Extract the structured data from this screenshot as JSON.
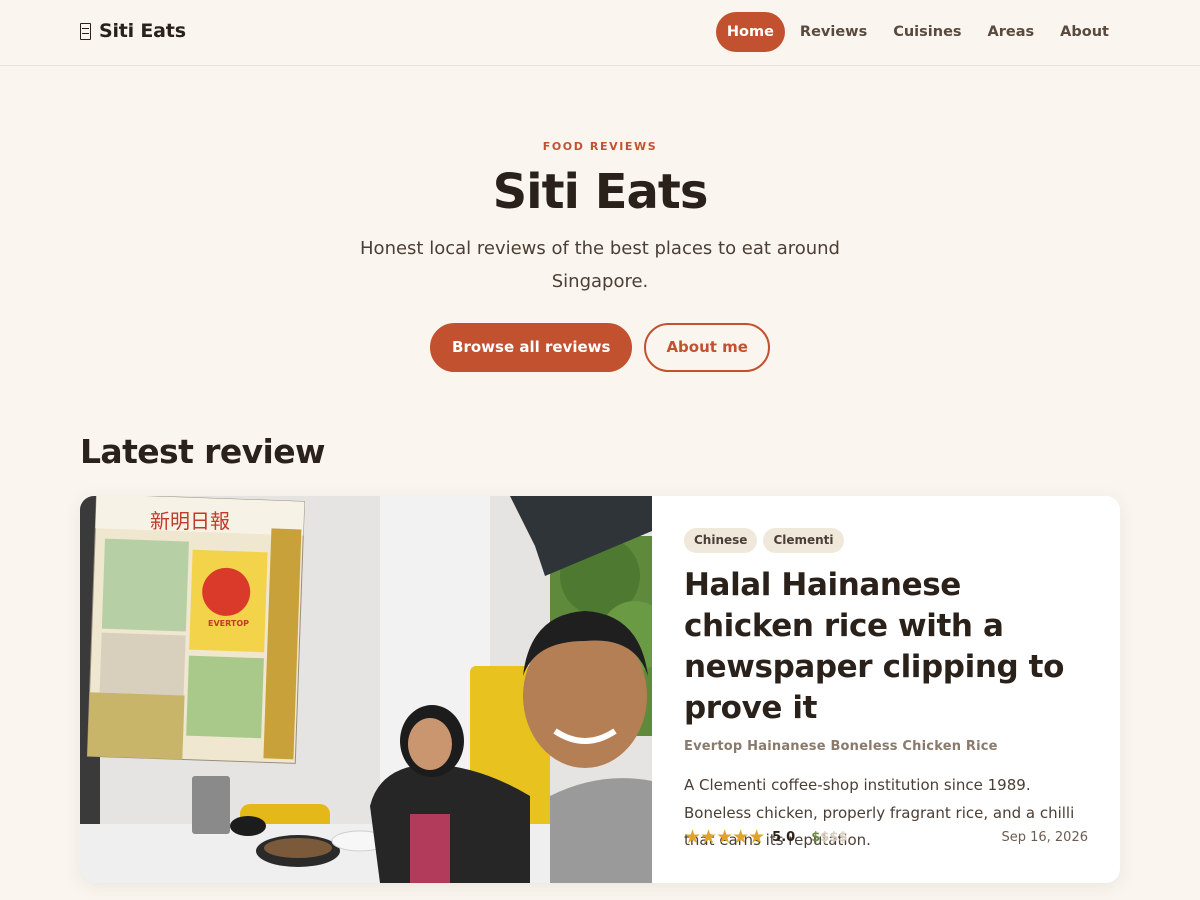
{
  "header": {
    "brand": "Siti Eats",
    "nav": [
      {
        "label": "Home",
        "active": true
      },
      {
        "label": "Reviews",
        "active": false
      },
      {
        "label": "Cuisines",
        "active": false
      },
      {
        "label": "Areas",
        "active": false
      },
      {
        "label": "About",
        "active": false
      }
    ]
  },
  "hero": {
    "eyebrow": "FOOD REVIEWS",
    "title": "Siti Eats",
    "subtitle": "Honest local reviews of the best places to eat around Singapore.",
    "primary_button": "Browse all reviews",
    "secondary_button": "About me"
  },
  "latest": {
    "section_title": "Latest review",
    "tags": [
      "Chinese",
      "Clementi"
    ],
    "title": "Halal Hainanese chicken rice with a newspaper clipping to prove it",
    "place": "Evertop Hainanese Boneless Chicken Rice",
    "excerpt": "A Clementi coffee-shop institution since 1989. Boneless chicken, properly fragrant rice, and a chilli that earns its reputation.",
    "stars": "★★★★★",
    "rating": "5.0",
    "price_on": "$",
    "price_off": "$$$",
    "date": "Sep 16, 2026",
    "photo_poster_title": "新明日報",
    "photo_poster_brand": "EVERTOP"
  },
  "colors": {
    "accent": "#c2522f",
    "background": "#faf6ef",
    "star": "#e0a32e",
    "price": "#6b8a3a"
  }
}
